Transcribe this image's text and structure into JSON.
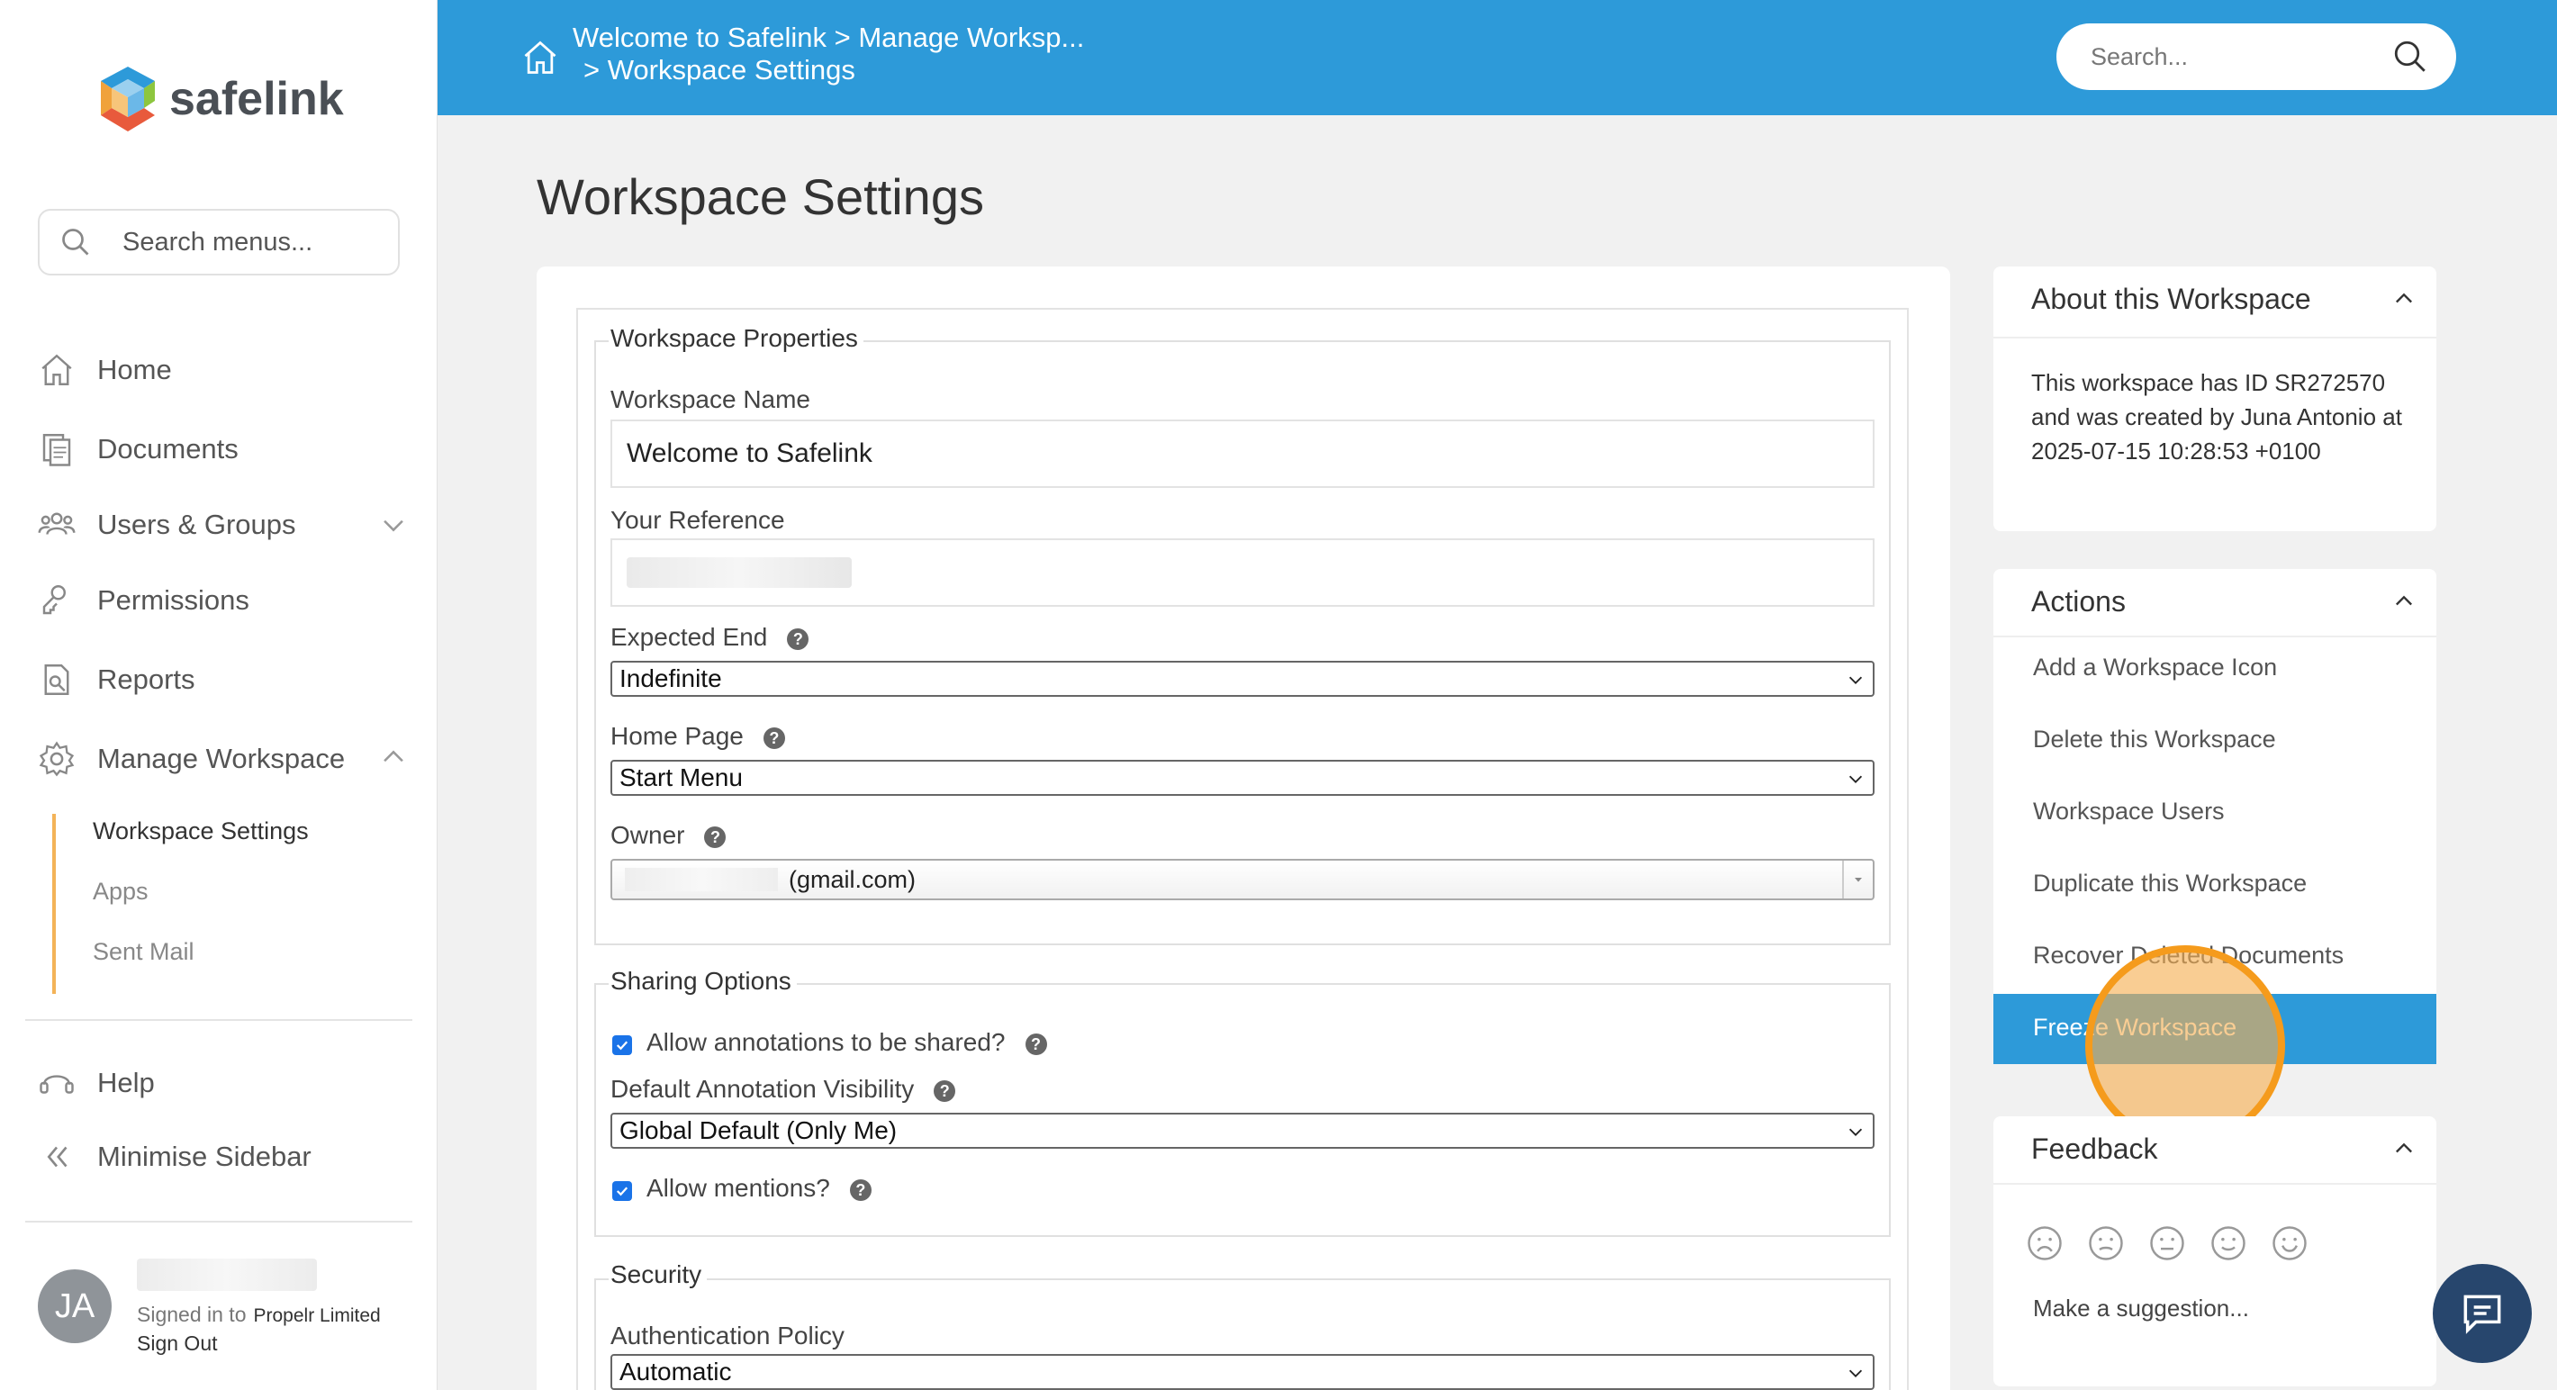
{
  "sidebar": {
    "logo_text": "safelink",
    "search_placeholder": "Search menus...",
    "items": [
      {
        "label": "Home"
      },
      {
        "label": "Documents"
      },
      {
        "label": "Users & Groups"
      },
      {
        "label": "Permissions"
      },
      {
        "label": "Reports"
      },
      {
        "label": "Manage Workspace"
      },
      {
        "label": "Help"
      },
      {
        "label": "Minimise Sidebar"
      }
    ],
    "subitems": [
      {
        "label": "Workspace Settings"
      },
      {
        "label": "Apps"
      },
      {
        "label": "Sent Mail"
      }
    ],
    "user": {
      "initials": "JA",
      "signed_in_prefix": "Signed in to",
      "org": "Propelr Limited",
      "sign_out": "Sign Out"
    }
  },
  "header": {
    "breadcrumb_line1": "Welcome to Safelink  >  Manage Worksp...",
    "breadcrumb_line2": ">  Workspace Settings",
    "search_placeholder": "Search..."
  },
  "page": {
    "title": "Workspace Settings"
  },
  "form": {
    "properties_legend": "Workspace Properties",
    "workspace_name_label": "Workspace Name",
    "workspace_name_value": "Welcome to Safelink",
    "reference_label": "Your Reference",
    "expected_end_label": "Expected End",
    "expected_end_value": "Indefinite",
    "home_page_label": "Home Page",
    "home_page_value": "Start Menu",
    "owner_label": "Owner",
    "owner_value": "(gmail.com)",
    "sharing_legend": "Sharing Options",
    "allow_annotations_label": "Allow annotations to be shared?",
    "annotation_visibility_label": "Default Annotation Visibility",
    "annotation_visibility_value": "Global Default (Only Me)",
    "allow_mentions_label": "Allow mentions?",
    "security_legend": "Security",
    "auth_policy_label": "Authentication Policy",
    "auth_policy_value": "Automatic"
  },
  "about": {
    "title": "About this Workspace",
    "body": "This workspace has ID SR272570 and was created by Juna Antonio at 2025-07-15 10:28:53 +0100"
  },
  "actions": {
    "title": "Actions",
    "items": [
      {
        "label": "Add a Workspace Icon"
      },
      {
        "label": "Delete this Workspace"
      },
      {
        "label": "Workspace Users"
      },
      {
        "label": "Duplicate this Workspace"
      },
      {
        "label": "Recover Deleted Documents"
      },
      {
        "label": "Freeze Workspace"
      }
    ]
  },
  "feedback": {
    "title": "Feedback",
    "suggest": "Make a suggestion..."
  },
  "colors": {
    "header_blue": "#2d9ad9",
    "highlight_orange": "#f59b1c",
    "chat_navy": "#27466d"
  }
}
